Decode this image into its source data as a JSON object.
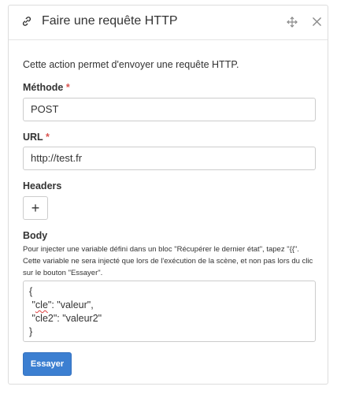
{
  "dialog": {
    "title": "Faire une requête HTTP",
    "icons": {
      "title_icon": "link-icon",
      "move_icon": "move-icon",
      "close_icon": "close-icon"
    }
  },
  "description": "Cette action permet d'envoyer une requête HTTP.",
  "fields": {
    "method": {
      "label": "Méthode",
      "required_mark": "*",
      "value": "POST"
    },
    "url": {
      "label": "URL",
      "required_mark": "*",
      "value": "http://test.fr"
    },
    "headers": {
      "label": "Headers",
      "add_button_symbol": "+"
    },
    "body": {
      "label": "Body",
      "help_text": "Pour injecter une variable défini dans un bloc \"Récupérer le dernier état\", tapez \"{{\". Cette variable ne sera injecté que lors de l'exécution de la scène, et non pas lors du clic sur le bouton \"Essayer\".",
      "lines": {
        "open": "{",
        "line1_key": "cle",
        "line1_rest": ": \"valeur\",",
        "line2": "\"cle2\": \"valeur2\"",
        "close": "}"
      }
    }
  },
  "actions": {
    "try_label": "Essayer"
  },
  "colors": {
    "primary": "#3c7fd1",
    "required": "#d9534f",
    "border": "#cccccc"
  }
}
